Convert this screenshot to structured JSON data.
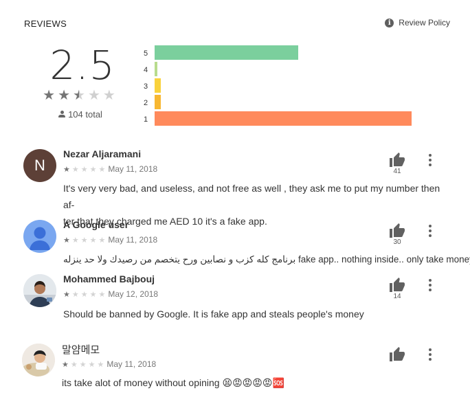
{
  "header": {
    "title": "REVIEWS",
    "policy_label": "Review Policy",
    "policy_icon": "info-icon"
  },
  "summary": {
    "rating": "2.5",
    "stars": 2.5,
    "total": "104 total"
  },
  "histogram": [
    {
      "label": "5",
      "fraction": 0.56,
      "color": "#7bcf9d"
    },
    {
      "label": "4",
      "fraction": 0.01,
      "color": "#b8dc8d"
    },
    {
      "label": "3",
      "fraction": 0.025,
      "color": "#f9d23c"
    },
    {
      "label": "2",
      "fraction": 0.025,
      "color": "#f7b731"
    },
    {
      "label": "1",
      "fraction": 1.0,
      "color": "#ff8a5c"
    }
  ],
  "reviews": [
    {
      "name": "Nezar Aljaramani",
      "avatar_letter": "N",
      "stars": 1,
      "date": "May 11, 2018",
      "text_line1": "It's very very bad, and useless, and not free as well , they ask me to put my number then af-",
      "text_line2": "ter that they charged me AED 10 it's a fake app.",
      "helpful": "41"
    },
    {
      "name": "A Google user",
      "stars": 1,
      "date": "May 11, 2018",
      "text_line1": "برنامج كله كزب و نصابين ورح يتخصم من رصيدك ولا حد ينزله fake app.. nothing inside.. only take money",
      "helpful": "30"
    },
    {
      "name": "Mohammed Bajbouj",
      "stars": 1,
      "date": "May 12, 2018",
      "text_line1": "Should be banned by Google. It is fake app and steals people's money",
      "helpful": "14"
    },
    {
      "name": "말얌메모",
      "stars": 1,
      "date": "May 11, 2018",
      "text_line1": "its take alot of money without opining 😫😡😡😡😡🆘",
      "helpful": ""
    }
  ]
}
